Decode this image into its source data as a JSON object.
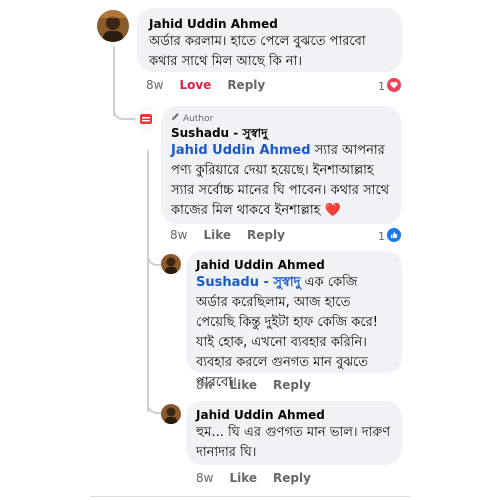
{
  "comments": [
    {
      "author": "Jahid Uddin Ahmed",
      "text": "অর্ডার করলাম। হাতে পেলে বুঝতে পারবো কথার সাথে মিল আছে কি না।",
      "time": "8w",
      "like_label": "Love",
      "reply_label": "Reply",
      "reaction_count": "1",
      "reaction_icon": "heart-icon"
    },
    {
      "author": "Sushadu - সুস্বাদু",
      "badge": "Author",
      "mention": "Jahid Uddin Ahmed",
      "text": " স্যার আপনার পণ্য কুরিয়ারে দেয়া হয়েছে। ইনশাআল্লাহ স্যার সর্বোচ্চ মানের ঘি পাবেন। কথার সাথে কাজের মিল থাকবে ইনশাল্লাহ ❤️",
      "time": "8w",
      "like_label": "Like",
      "reply_label": "Reply",
      "reaction_count": "1",
      "reaction_icon": "like-icon"
    },
    {
      "author": "Jahid Uddin Ahmed",
      "mention": "Sushadu - সুস্বাদু",
      "text": " এক কেজি অর্ডার করেছিলাম, আজ হাতে পেয়েছি কিন্তু দুইটা হাফ কেজি করে! যাই হোক, এখনো ব্যবহার করিনি। ব্যবহার করলে গুনগত মান বুঝতে পারবো।",
      "time": "8w",
      "like_label": "Like",
      "reply_label": "Reply"
    },
    {
      "author": "Jahid Uddin Ahmed",
      "text": "হুম... ঘি এর গুণগত মান ভাল। দারুণ দানাদার ঘি।",
      "time": "8w",
      "like_label": "Like",
      "reply_label": "Reply"
    }
  ],
  "colors": {
    "love": "#e41e3f",
    "mention": "#1b5bc7",
    "like_blue": "#1877f2",
    "bubble": "#f0f2f5"
  }
}
